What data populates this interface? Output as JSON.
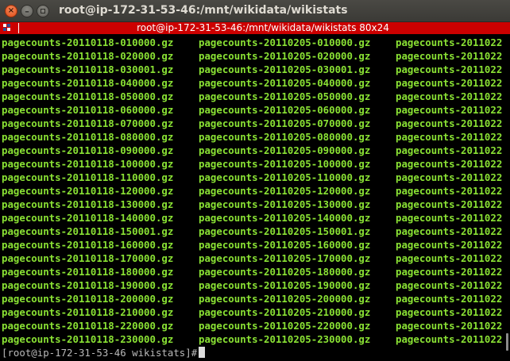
{
  "window": {
    "title": "root@ip-172-31-53-46:/mnt/wikidata/wikistats"
  },
  "header": {
    "text": "root@ip-172-31-53-46:/mnt/wikidata/wikistats 80x24"
  },
  "terminal": {
    "rows": [
      [
        "pagecounts-20110118-010000.gz",
        "pagecounts-20110205-010000.gz",
        "pagecounts-2011022"
      ],
      [
        "pagecounts-20110118-020000.gz",
        "pagecounts-20110205-020000.gz",
        "pagecounts-2011022"
      ],
      [
        "pagecounts-20110118-030001.gz",
        "pagecounts-20110205-030001.gz",
        "pagecounts-2011022"
      ],
      [
        "pagecounts-20110118-040000.gz",
        "pagecounts-20110205-040000.gz",
        "pagecounts-2011022"
      ],
      [
        "pagecounts-20110118-050000.gz",
        "pagecounts-20110205-050000.gz",
        "pagecounts-2011022"
      ],
      [
        "pagecounts-20110118-060000.gz",
        "pagecounts-20110205-060000.gz",
        "pagecounts-2011022"
      ],
      [
        "pagecounts-20110118-070000.gz",
        "pagecounts-20110205-070000.gz",
        "pagecounts-2011022"
      ],
      [
        "pagecounts-20110118-080000.gz",
        "pagecounts-20110205-080000.gz",
        "pagecounts-2011022"
      ],
      [
        "pagecounts-20110118-090000.gz",
        "pagecounts-20110205-090000.gz",
        "pagecounts-2011022"
      ],
      [
        "pagecounts-20110118-100000.gz",
        "pagecounts-20110205-100000.gz",
        "pagecounts-2011022"
      ],
      [
        "pagecounts-20110118-110000.gz",
        "pagecounts-20110205-110000.gz",
        "pagecounts-2011022"
      ],
      [
        "pagecounts-20110118-120000.gz",
        "pagecounts-20110205-120000.gz",
        "pagecounts-2011022"
      ],
      [
        "pagecounts-20110118-130000.gz",
        "pagecounts-20110205-130000.gz",
        "pagecounts-2011022"
      ],
      [
        "pagecounts-20110118-140000.gz",
        "pagecounts-20110205-140000.gz",
        "pagecounts-2011022"
      ],
      [
        "pagecounts-20110118-150001.gz",
        "pagecounts-20110205-150001.gz",
        "pagecounts-2011022"
      ],
      [
        "pagecounts-20110118-160000.gz",
        "pagecounts-20110205-160000.gz",
        "pagecounts-2011022"
      ],
      [
        "pagecounts-20110118-170000.gz",
        "pagecounts-20110205-170000.gz",
        "pagecounts-2011022"
      ],
      [
        "pagecounts-20110118-180000.gz",
        "pagecounts-20110205-180000.gz",
        "pagecounts-2011022"
      ],
      [
        "pagecounts-20110118-190000.gz",
        "pagecounts-20110205-190000.gz",
        "pagecounts-2011022"
      ],
      [
        "pagecounts-20110118-200000.gz",
        "pagecounts-20110205-200000.gz",
        "pagecounts-2011022"
      ],
      [
        "pagecounts-20110118-210000.gz",
        "pagecounts-20110205-210000.gz",
        "pagecounts-2011022"
      ],
      [
        "pagecounts-20110118-220000.gz",
        "pagecounts-20110205-220000.gz",
        "pagecounts-2011022"
      ],
      [
        "pagecounts-20110118-230000.gz",
        "pagecounts-20110205-230000.gz",
        "pagecounts-2011022"
      ]
    ],
    "prompt": "[root@ip-172-31-53-46 wikistats]#"
  },
  "icons": {
    "close": "close-icon",
    "minimize": "minimize-icon",
    "maximize": "maximize-icon",
    "terminal_logo": "screen-logo-icon"
  },
  "colors": {
    "file_text": "#8ae234",
    "header_bar": "#cc0000",
    "titlebar": "#3c3b37"
  }
}
